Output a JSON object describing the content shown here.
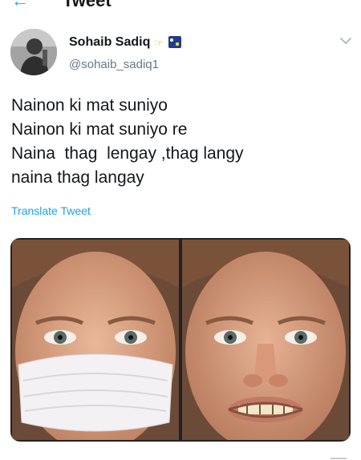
{
  "header": {
    "title": "Tweet",
    "back_icon": "arrow-left-icon"
  },
  "tweet": {
    "author": {
      "name": "Sohaib Sadiq",
      "handle": "@sohaib_sadiq1",
      "name_emojis": [
        "hand-pointing-icon",
        "night-sky-flag-icon"
      ]
    },
    "text_lines": [
      "Nainon ki mat suniyo",
      "Nainon ki mat suniyo re",
      "Naina  thag  lengay ,thag langy",
      "naina thag langay"
    ],
    "translate_label": "Translate Tweet",
    "media": {
      "panels": [
        "left-photo-with-mask",
        "right-photo-without-mask"
      ]
    }
  },
  "colors": {
    "accent": "#1da1f2",
    "text": "#14171a",
    "secondary_text": "#657786",
    "background": "#ffffff"
  }
}
